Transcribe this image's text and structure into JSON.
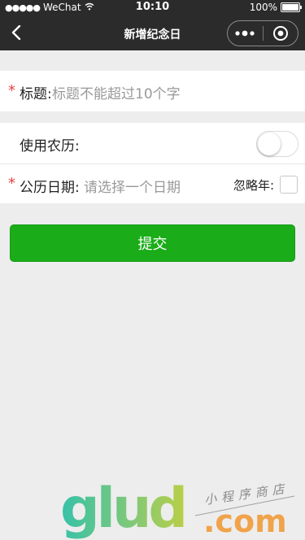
{
  "statusbar": {
    "signal": "●●●●●",
    "carrier": "WeChat",
    "time": "10:10",
    "battery": "100%"
  },
  "navbar": {
    "title": "新增纪念日"
  },
  "form": {
    "title_label": "标题:",
    "title_placeholder": "标题不能超过10个字",
    "lunar_label": "使用农历:",
    "lunar_enabled": false,
    "date_label": "公历日期:",
    "date_placeholder": "请选择一个日期",
    "ignore_year_label": "忽略年:",
    "ignore_year_checked": false,
    "required_mark": "*"
  },
  "submit": {
    "label": "提交",
    "color": "#1aad19"
  },
  "watermark": {
    "brand": "glud",
    "domain": ".com",
    "tagline": "小程序商店"
  }
}
